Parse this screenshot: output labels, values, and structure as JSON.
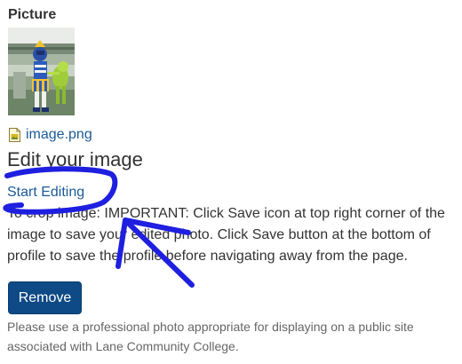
{
  "field": {
    "label": "Picture"
  },
  "file": {
    "icon": "image-file-icon",
    "name": "image.png"
  },
  "editor": {
    "title": "Edit your image",
    "start_label": "Start Editing",
    "instructions": "To crop image: IMPORTANT: Click Save icon at top right corner of the image to save your edited photo. Click Save button at the bottom of profile to save the profile before navigating away from the page."
  },
  "actions": {
    "remove_label": "Remove"
  },
  "help": {
    "text": "Please use a professional photo appropriate for displaying on a public site associated with Lane Community College."
  },
  "colors": {
    "link": "#1a5a96",
    "button": "#0e4a85",
    "annotation": "#1f1fe0"
  }
}
